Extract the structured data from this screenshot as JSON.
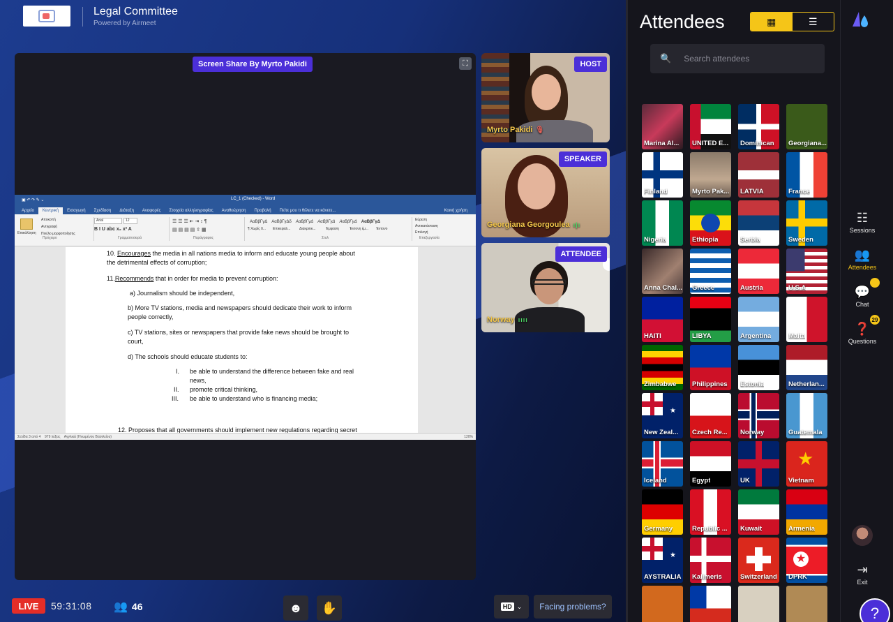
{
  "header": {
    "title": "Legal Committee",
    "powered_by": "Powered by Airmeet"
  },
  "stage": {
    "share_label": "Screen Share By Myrto Pakidi",
    "word": {
      "window_title": "LC_1 (Checked) - Word",
      "tabs": [
        "Αρχείο",
        "Κεντρική",
        "Εισαγωγή",
        "Σχεδίαση",
        "Διάταξη",
        "Αναφορές",
        "Στοιχεία αλληλογραφίας",
        "Αναθεώρηση",
        "Προβολή",
        "Πείτε μου τι θέλετε να κάνετε..."
      ],
      "share": "Κοινή χρήση",
      "ribbon": {
        "paste": "Επικόλληση",
        "cut": "Αποκοπή",
        "copy": "Αντιγραφή",
        "format_painter": "Πινέλο μορφοποίησης",
        "clipboard": "Πρόχειρο",
        "font_name": "Arial",
        "font_size": "12",
        "font_group": "Γραμματοσειρά",
        "paragraph_group": "Παράγραφος",
        "styles_group": "Στυλ",
        "editing_group": "Επεξεργασία",
        "find": "Εύρεση",
        "replace": "Αντικατάσταση",
        "select": "Επιλογή",
        "styles": [
          "ΑαΒβΓγΔ",
          "ΑαΒβΓγΔδ",
          "ΑαΒβΓγΔ",
          "ΑαΒβΓγΔ",
          "ΑαΒβΓγΔ",
          "ΑαΒβΓγΔ"
        ],
        "style_names": [
          "¶ Χωρίς δ...",
          "Επικεφαλ...",
          "Διακριτικ...",
          "Έμφαση",
          "Έντονη έμ...",
          "Έντονο"
        ]
      },
      "doc": {
        "p10_head": "10. ",
        "p10_verb": "Encourages",
        "p10_rest": " the media in all nations media to inform and educate young people about",
        "p10_line2": "the detrimental effects of corruption;",
        "p11_head": "11.",
        "p11_verb": "Recommends",
        "p11_rest": " that in order for media to prevent corruption:",
        "a": "a) Journalism should be independent,",
        "b1": "b) More TV stations, media and newspapers should dedicate their work to inform",
        "b2": "people correctly,",
        "c1": "c) TV stations, sites or newspapers that provide fake news should be brought to",
        "c2": "court,",
        "d": "d) The schools should educate students to:",
        "i_num": "I.",
        "i1": "be able to understand the difference between fake and real",
        "i2": "news,",
        "ii_num": "II.",
        "ii": "promote critical thinking,",
        "iii_num": "III.",
        "iii": "be able to understand who is financing media;",
        "p12": "12. Proposes that all governments should implement new regulations regarding secret"
      },
      "status": {
        "page": "Σελίδα 3 από 4",
        "words": "979 λέξεις",
        "lang": "Αγγλικά (Ηνωμένου Βασιλείου)",
        "zoom": "120%"
      }
    }
  },
  "tiles": [
    {
      "role": "HOST",
      "name": "Myrto Pakidi",
      "indicator": "🎙"
    },
    {
      "role": "SPEAKER",
      "name": "Georgiana Georgoulea",
      "indicator": "ı|ı"
    },
    {
      "role": "ATTENDEE",
      "name": "Norway",
      "indicator": "ıııı"
    }
  ],
  "attendees_panel": {
    "title": "Attendees",
    "search_placeholder": "Search attendees",
    "grid_icon": "▦",
    "list_icon": "☰",
    "search_icon": "🔍",
    "items": [
      {
        "name": "Marina Al...",
        "bg": "photo1"
      },
      {
        "name": "UNITED E...",
        "bg": "uae"
      },
      {
        "name": "Dominican",
        "bg": "dominican"
      },
      {
        "name": "Georgiana...",
        "bg": "green"
      },
      {
        "name": "Finland",
        "bg": "finland"
      },
      {
        "name": "Myrto Pak...",
        "bg": "photo2"
      },
      {
        "name": "LATVIA",
        "bg": "latvia"
      },
      {
        "name": "France",
        "bg": "france"
      },
      {
        "name": "Nigeria",
        "bg": "nigeria"
      },
      {
        "name": "Ethiopia",
        "bg": "ethiopia"
      },
      {
        "name": "Serbia",
        "bg": "serbia"
      },
      {
        "name": "Sweden",
        "bg": "sweden"
      },
      {
        "name": "Anna Chal...",
        "bg": "photo3"
      },
      {
        "name": "Greece",
        "bg": "greece"
      },
      {
        "name": "Austria",
        "bg": "austria"
      },
      {
        "name": "U.S.A",
        "bg": "usa"
      },
      {
        "name": "HAITI",
        "bg": "haiti"
      },
      {
        "name": "LIBYA",
        "bg": "libya"
      },
      {
        "name": "Argentina",
        "bg": "argentina"
      },
      {
        "name": "Malta",
        "bg": "malta"
      },
      {
        "name": "Zimbabwe",
        "bg": "zimbabwe"
      },
      {
        "name": "Philippines",
        "bg": "philippines"
      },
      {
        "name": "Estonia",
        "bg": "estonia"
      },
      {
        "name": "Netherlan...",
        "bg": "netherlands"
      },
      {
        "name": "New Zeal...",
        "bg": "nz"
      },
      {
        "name": "Czech Re...",
        "bg": "czech"
      },
      {
        "name": "Norway",
        "bg": "norway"
      },
      {
        "name": "Guatemala",
        "bg": "guatemala"
      },
      {
        "name": "Iceland",
        "bg": "iceland"
      },
      {
        "name": "Egypt",
        "bg": "egypt"
      },
      {
        "name": "UK",
        "bg": "uk"
      },
      {
        "name": "Vietnam",
        "bg": "vietnam"
      },
      {
        "name": "Germany",
        "bg": "germany"
      },
      {
        "name": "Republic ...",
        "bg": "peru"
      },
      {
        "name": "Kuwait",
        "bg": "kuwait"
      },
      {
        "name": "Armenia",
        "bg": "armenia"
      },
      {
        "name": "AYSTRALIA",
        "bg": "australia"
      },
      {
        "name": "Kalimeris",
        "bg": "denmark"
      },
      {
        "name": "Switzerland",
        "bg": "swiss"
      },
      {
        "name": "DPRK",
        "bg": "dprk"
      },
      {
        "name": "",
        "bg": "orange"
      },
      {
        "name": "",
        "bg": "chile"
      },
      {
        "name": "",
        "bg": "seal"
      },
      {
        "name": "",
        "bg": "tan"
      }
    ]
  },
  "rail": {
    "sessions": "Sessions",
    "attendees": "Attendees",
    "chat": "Chat",
    "questions": "Questions",
    "questions_count": "29",
    "exit": "Exit",
    "help": "?"
  },
  "bottom": {
    "live": "LIVE",
    "timer": "59:31:08",
    "count": "46",
    "emoji_icon": "☻",
    "hand_icon": "✋",
    "hd": "HD",
    "facing": "Facing problems?"
  },
  "colors": {
    "accent": "#4b2fd8",
    "highlight": "#f5c518",
    "live": "#e52d27"
  }
}
